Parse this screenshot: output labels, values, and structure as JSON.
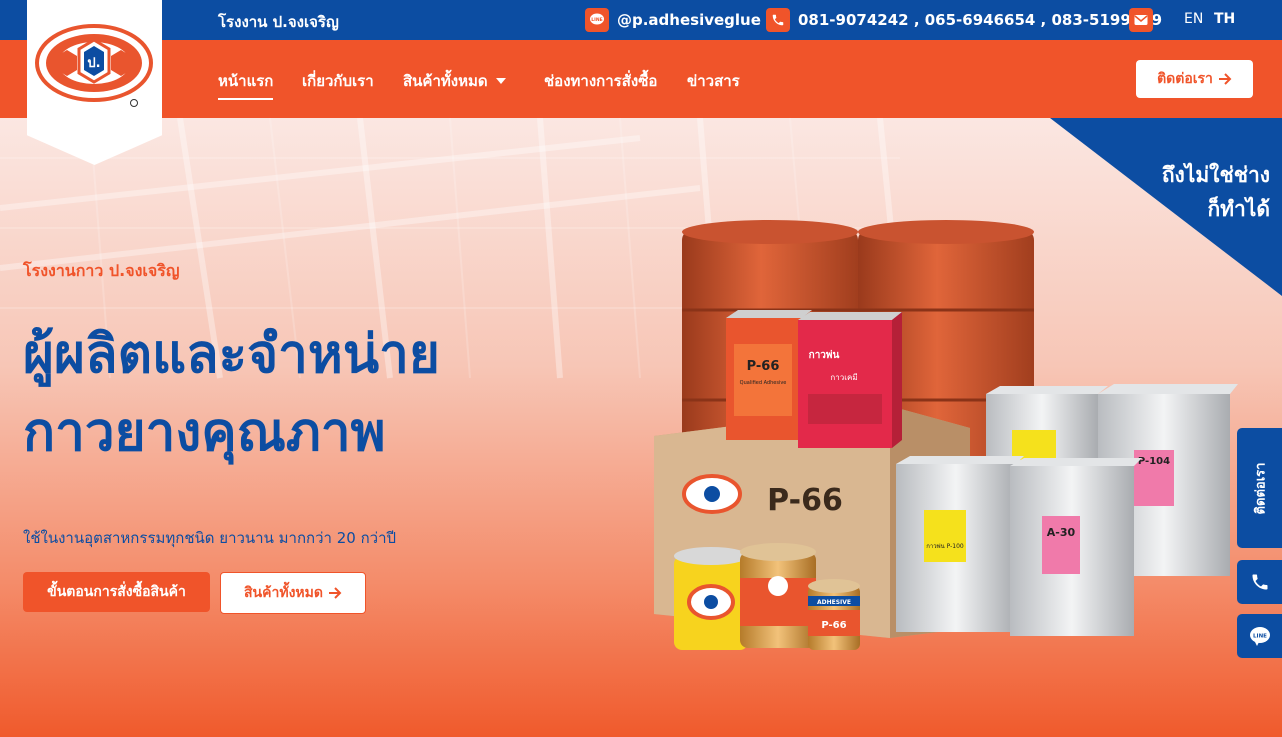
{
  "topbar": {
    "factory_name": "โรงงาน ป.จงเจริญ",
    "line_id": "@p.adhesiveglue",
    "phones": "081-9074242 , 065-6946654 , 083-5199559",
    "lang_en": "EN",
    "lang_th": "TH"
  },
  "nav": {
    "items": [
      {
        "label": "หน้าแรก"
      },
      {
        "label": "เกี่ยวกับเรา"
      },
      {
        "label": "สินค้าทั้งหมด"
      },
      {
        "label": "ช่องทางการสั่งซื้อ"
      },
      {
        "label": "ข่าวสาร"
      }
    ],
    "contact_button": "ติดต่อเรา"
  },
  "hero": {
    "banner_line1": "ถึงไม่ใช่ช่าง",
    "banner_line2": "ก็ทำได้",
    "eyebrow": "โรงงานกาว ป.จงเจริญ",
    "headline_line1": "ผู้ผลิตและจำหน่าย",
    "headline_line2": "กาวยางคุณภาพ",
    "subline": "ใช้ในงานอุตสาหกรรมทุกชนิด ยาวนาน มากกว่า 20 กว่าปี",
    "btn_order": "ขั้นตอนการสั่งซื้อสินค้า",
    "btn_products": "สินค้าทั้งหมด"
  },
  "products": {
    "box_label": "P-66",
    "tin1_title": "P-66",
    "tin1_sub": "Qualified Adhesive",
    "tin2_title": "กาวพ่น",
    "tin2_sub": "กาวเคมี",
    "can_small_label": "ADHESIVE",
    "can_small_text": "P-66",
    "silver1_label": "A-30",
    "silver2_label": "กาวพ่น P-100",
    "silver3_label": "P-104"
  },
  "side": {
    "contact": "ติดต่อเรา"
  },
  "colors": {
    "brand_blue": "#0c4da2",
    "brand_orange": "#f0542a"
  }
}
